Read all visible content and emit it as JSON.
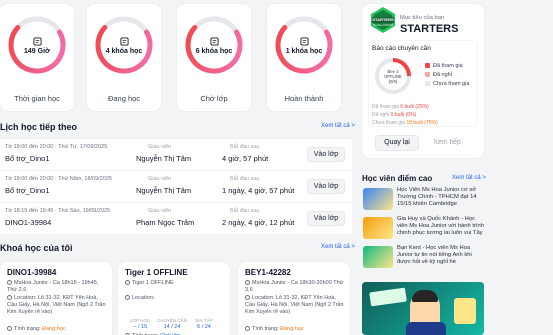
{
  "stats": [
    {
      "value": "149 Giờ",
      "label": "Thời gian học",
      "fraction": 0.7
    },
    {
      "value": "4 khóa học",
      "label": "Đang học",
      "fraction": 0.7
    },
    {
      "value": "6 khóa học",
      "label": "Chờ lớp",
      "fraction": 0.7
    },
    {
      "value": "1 khóa học",
      "label": "Hoàn thành",
      "fraction": 0.7
    }
  ],
  "schedule": {
    "title": "Lịch học tiếp theo",
    "see_all": "Xem tất cả >",
    "teacher_label": "Giáo viên",
    "start_label": "Bắt đầu sau",
    "join_label": "Vào lớp",
    "rows": [
      {
        "time": "Từ 19:00 đến 20:00 · Thứ Tư, 17/09/2025",
        "name": "Bổ trợ_Dino1",
        "teacher": "Nguyễn Thị Tâm",
        "starts_in": "4 giờ, 57 phút"
      },
      {
        "time": "Từ 19:00 đến 20:00 · Thứ Năm, 18/09/2025",
        "name": "Bổ trợ_Dino1",
        "teacher": "Nguyễn Thị Tâm",
        "starts_in": "1 ngày, 4 giờ, 57 phút"
      },
      {
        "time": "Từ 18:15 đến 19:45 · Thứ Sáu, 19/09/2025",
        "name": "DINO1-39984",
        "teacher": "Phạm Ngọc Trâm",
        "starts_in": "2 ngày, 4 giờ, 12 phút"
      }
    ]
  },
  "courses": {
    "title": "Khoá học của tôi",
    "see_all": "Xem tất cả >",
    "items": [
      {
        "name": "DINO1-39984",
        "line1": "MsHoa Junior - Ca 18h15 - 19h45, Thứ 2,6",
        "line2": "Location: Lô 31-32, KĐT Yên Hoà, Cầu Giấy, Hà Nội, Việt Nam (Ngõ 2 Trần Kim Xuyến rẽ vào)",
        "status_label": "Tình trạng:",
        "status": "Đang học",
        "status_color": "#f97316"
      },
      {
        "name": "Tiger 1 OFFLINE",
        "line1": "Tiger 1 OFFLINE",
        "line2": "Location:",
        "status_label": "Tình trạng:",
        "status": "Chờ lớp",
        "status_color": "#2563eb",
        "progress_labels": [
          "LỚP HỌC",
          "CHUYÊN CẦN",
          "BÀI TẬP"
        ],
        "progress_values": [
          "-- / 15",
          "14 / 24",
          "6 / 24"
        ]
      },
      {
        "name": "BEY1-42282",
        "line1": "MsHoa Junior - Ca 18h30-20h00 Thứ 3,6",
        "line2": "Location: Lô 31-32, KĐT Yên Hoà, Cầu Giấy, Hà Nội, Việt Nam (Ngõ 2 Trần Kim Xuyến rẽ vào)",
        "status_label": "Tình trạng:",
        "status": "Đang học",
        "status_color": "#f97316"
      }
    ]
  },
  "profile": {
    "badge_top": "STARTERS",
    "badge_sub": "MsHoa JUNIOR",
    "goal_label": "Mục tiêu của bạn",
    "goal": "STARTERS"
  },
  "attendance": {
    "title": "Báo cáo chuyên cần",
    "center_line1": "Bee 2",
    "center_line2": "OFFLINE",
    "center_line3": "(0/0)",
    "legend": [
      {
        "label": "Đã tham gia",
        "color": "#ef4444"
      },
      {
        "label": "Đã nghỉ",
        "color": "#fca5a5"
      },
      {
        "label": "Chưa tham gia",
        "color": "#e5e7eb"
      }
    ],
    "stats": [
      {
        "text": "Đã tham gia",
        "value": "6 buổi (25%)",
        "color": "#ef4444"
      },
      {
        "text": "Đã nghỉ",
        "value": "0 buổi (0%)",
        "color": "#ef4444"
      },
      {
        "text": "Chưa tham gia",
        "value": "18 buổi (75%)",
        "color": "#f97316"
      }
    ],
    "back_label": "Quay lại",
    "next_label": "Xem tiếp"
  },
  "students": {
    "title": "Học viên điểm cao",
    "see_all": "Xem tất cả >",
    "items": [
      {
        "text": "Học Viên Ms Hoa Junior cơ sở Trường Chinh - TPHCM đạt 14 15/15 khiên Cambridge",
        "color": "#3b82f6"
      },
      {
        "text": "Gia Huy và Quốc Khánh - Học viên Ms Hoa Junior với hành trình chinh phục tương lai luôn vui Tây",
        "color": "#f59e0b"
      },
      {
        "text": "Bạn Kent - Học viên Ms Hoa Junior tự tin nói tiếng Anh khi được hỏi về kỳ nghỉ hè",
        "color": "#10b981"
      }
    ]
  },
  "colors": {
    "accent": "#ef4444",
    "gradient_end": "#f472b6",
    "link": "#2563eb"
  }
}
